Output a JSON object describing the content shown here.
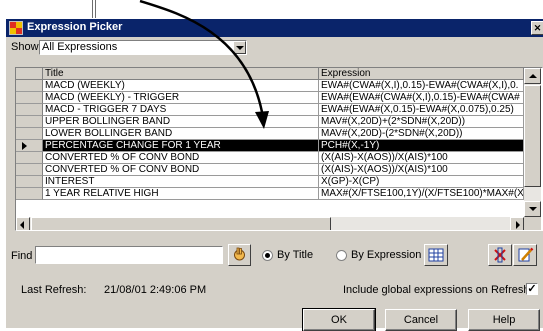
{
  "window": {
    "title": "Expression Picker"
  },
  "show": {
    "label": "Show",
    "value": "All Expressions"
  },
  "table": {
    "columns": [
      "Title",
      "Expression"
    ],
    "rows": [
      {
        "title": "MACD (WEEKLY)",
        "expression": "EWA#(CWA#(X,I),0.15)-EWA#(CWA#(X,I),0."
      },
      {
        "title": "MACD (WEEKLY) - TRIGGER",
        "expression": "EWA#(EWA#(CWA#(X,I),0.15)-EWA#(CWA#"
      },
      {
        "title": "MACD - TRIGGER 7 DAYS",
        "expression": "EWA#(EWA#(X,0.15)-EWA#(X,0.075),0.25)"
      },
      {
        "title": "UPPER BOLLINGER BAND",
        "expression": "MAV#(X,20D)+(2*SDN#(X,20D))"
      },
      {
        "title": "LOWER BOLLINGER BAND",
        "expression": "MAV#(X,20D)-(2*SDN#(X,20D))"
      },
      {
        "title": "PERCENTAGE CHANGE FOR 1 YEAR",
        "expression": "PCH#(X,-1Y)",
        "selected": true
      },
      {
        "title": "CONVERTED % OF CONV BOND",
        "expression": "(X(AIS)-X(AOS))/X(AIS)*100"
      },
      {
        "title": "CONVERTED % OF CONV BOND",
        "expression": "(X(AIS)-X(AOS))/X(AIS)*100"
      },
      {
        "title": "INTEREST",
        "expression": "X(GP)-X(CP)"
      },
      {
        "title": "1 YEAR RELATIVE HIGH",
        "expression": "MAX#(X/FTSE100,1Y)/(X/FTSE100)*MAX#(X"
      }
    ]
  },
  "find": {
    "label": "Find",
    "value": "",
    "by_title_label": "By Title",
    "by_expression_label": "By Expression",
    "mode": "title"
  },
  "last_refresh": {
    "label": "Last Refresh:",
    "value": "21/08/01 2:49:06 PM"
  },
  "include_global": {
    "label": "Include global expressions on Refresh",
    "checked": true
  },
  "buttons": {
    "ok": "OK",
    "cancel": "Cancel",
    "help": "Help"
  },
  "colors": {
    "title_bar": "#0a246a",
    "face": "#d4d0c8",
    "selection": "#000000",
    "arrow": "#000000"
  },
  "icons": {
    "app": "expression-picker-icon",
    "close": "close-icon",
    "find": "hand-search-icon",
    "calendar": "grid-table-icon",
    "tool1": "red-x-icon",
    "tool2": "pencil-edit-icon"
  }
}
